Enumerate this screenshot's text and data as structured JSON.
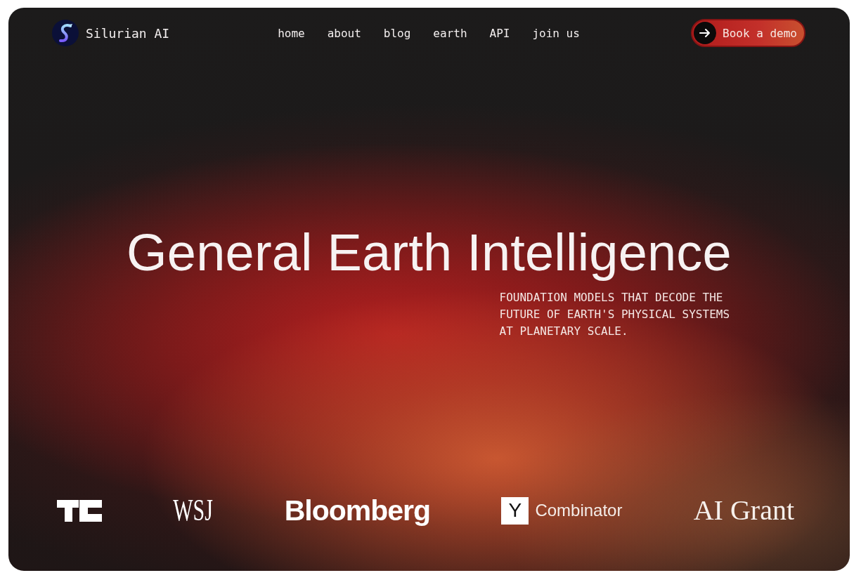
{
  "brand": {
    "name": "Silurian AI"
  },
  "nav": {
    "links": [
      "home",
      "about",
      "blog",
      "earth",
      "API",
      "join us"
    ]
  },
  "cta": {
    "label": "Book a demo"
  },
  "hero": {
    "title": "General Earth Intelligence",
    "subtitle": "FOUNDATION MODELS THAT DECODE THE FUTURE OF EARTH'S PHYSICAL SYSTEMS AT PLANETARY SCALE."
  },
  "press_logos": [
    {
      "kind": "blocks"
    },
    {
      "kind": "condensed",
      "text": "WSJ"
    },
    {
      "kind": "heavy",
      "text": "Bloomberg"
    },
    {
      "kind": "tile",
      "tile": "Y",
      "text": "Combinator"
    },
    {
      "kind": "serif",
      "text": "AI Grant"
    }
  ]
}
